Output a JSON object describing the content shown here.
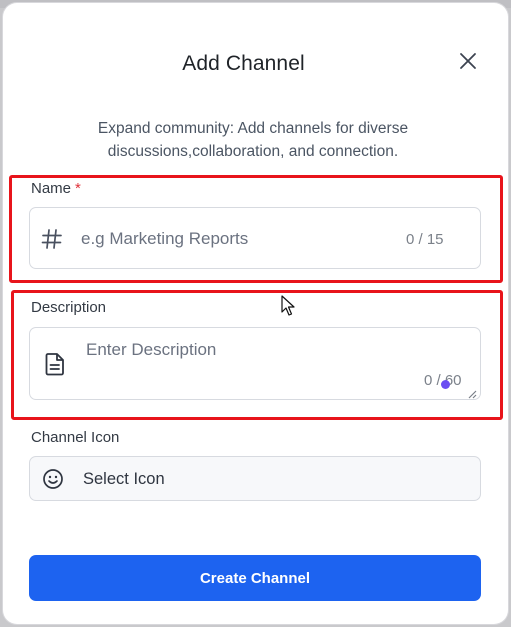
{
  "modal": {
    "title": "Add Channel",
    "subtitle": "Expand community: Add channels for diverse discussions,collaboration, and connection."
  },
  "name_field": {
    "label": "Name",
    "required_mark": "*",
    "placeholder": "e.g Marketing Reports",
    "value": "",
    "counter": "0 / 15",
    "icon": "hash-icon"
  },
  "description_field": {
    "label": "Description",
    "placeholder": "Enter Description",
    "value": "",
    "counter": "0 / 60",
    "icon": "document-icon"
  },
  "icon_field": {
    "label": "Channel Icon",
    "placeholder": "Select Icon",
    "icon": "smiley-icon"
  },
  "actions": {
    "create_label": "Create Channel"
  },
  "colors": {
    "accent": "#1d63f0",
    "highlight": "#e8141b",
    "required": "#e0323a"
  }
}
